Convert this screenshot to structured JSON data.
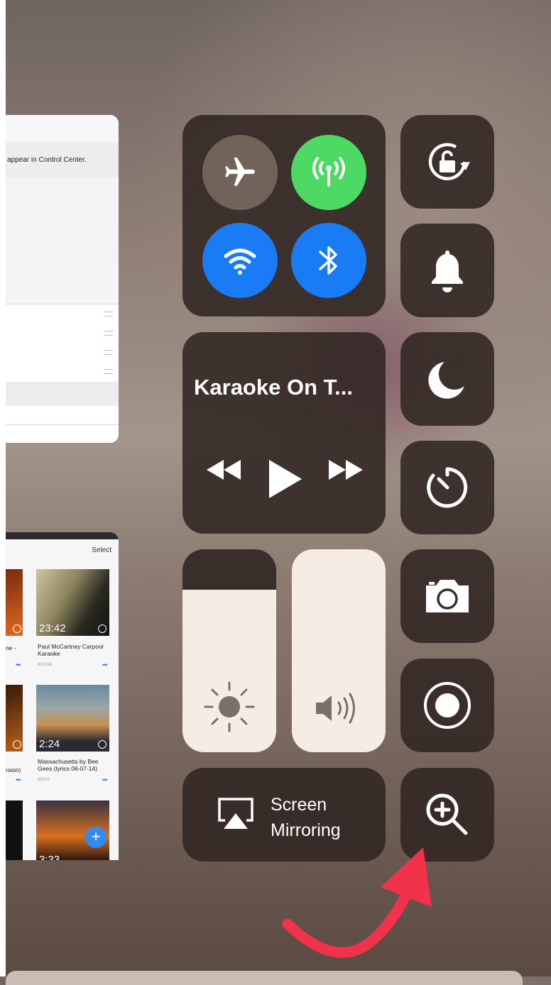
{
  "settings_card": {
    "info_text": "appear in Control Center."
  },
  "videos_card": {
    "select_label": "Select",
    "videos": [
      {
        "duration": "23:42",
        "caption": "Paul McCartney Carpool Karaoke",
        "date": "6/23/18"
      },
      {
        "duration": "2:24",
        "caption": "Massachusetts by Bee Gees (lyrics 06-07-14)",
        "date": "6/8/18"
      },
      {
        "duration": "3:33"
      }
    ],
    "left_partial": {
      "caption1": "ne -",
      "caption2": "rsion)"
    },
    "fab_label": "+"
  },
  "control_center": {
    "now_playing_title": "Karaoke On T...",
    "screen_mirroring_line1": "Screen",
    "screen_mirroring_line2": "Mirroring",
    "brightness_level": 0.8,
    "volume_level": 1.0
  },
  "colors": {
    "cellular_active": "#4cd964",
    "wifi_active": "#1a7cf5",
    "bluetooth_active": "#1a7cf5",
    "annotation_arrow": "#f0334a"
  }
}
